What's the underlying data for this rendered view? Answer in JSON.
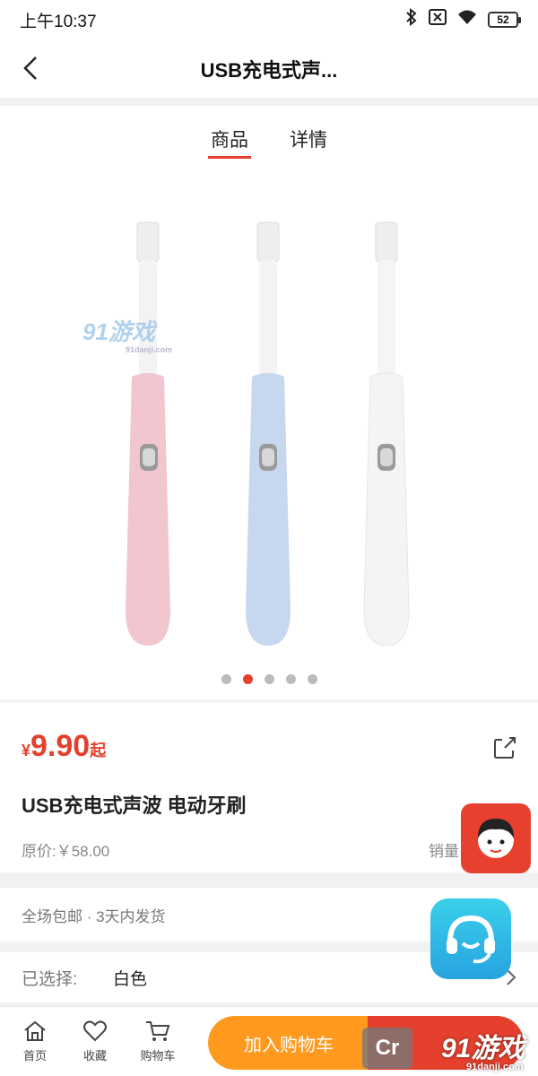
{
  "status": {
    "time": "上午10:37",
    "battery": "52"
  },
  "nav": {
    "title": "USB充电式声..."
  },
  "tabs": [
    {
      "label": "商品",
      "active": true
    },
    {
      "label": "详情",
      "active": false
    }
  ],
  "gallery": {
    "watermark": "91游戏",
    "watermark_sub": "91danji.com",
    "product_colors": [
      "#f2c6cf",
      "#c7d7ee",
      "#f4f4f6"
    ],
    "slide_count": 5,
    "active_slide": 2
  },
  "product": {
    "currency": "¥",
    "price": "9.90",
    "price_suffix": "起",
    "title": "USB充电式声波 电动牙刷",
    "original_price": "原价:￥58.00",
    "sales_label": "销量"
  },
  "service": {
    "text": "全场包邮 · 3天内发货"
  },
  "spec": {
    "label": "已选择:",
    "value": "白色"
  },
  "bottom_bar": {
    "home": "首页",
    "favorite": "收藏",
    "cart": "购物车",
    "add_to_cart": "加入购物车"
  },
  "watermarks": {
    "bottom": "91游戏",
    "bottom_sub": "91danji.com",
    "cr": "Cr"
  },
  "colors": {
    "accent": "#e5402d",
    "cart_button": "#ff9a1f"
  }
}
